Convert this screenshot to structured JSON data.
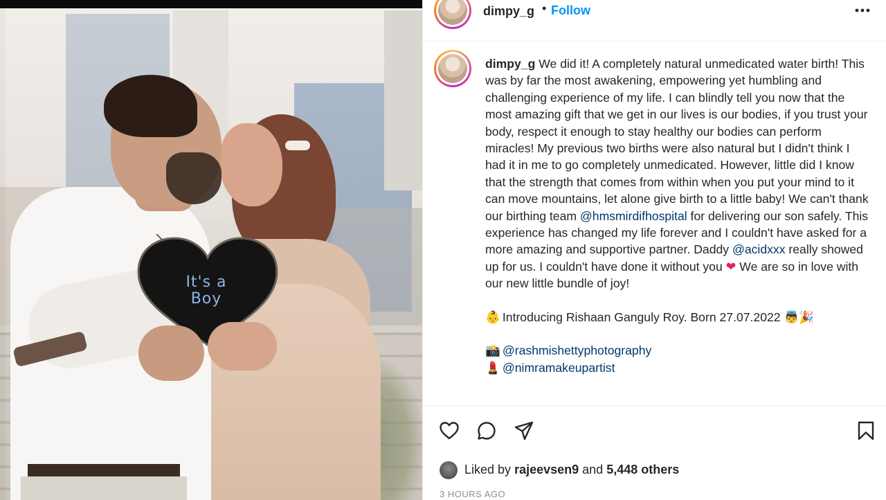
{
  "header": {
    "username": "dimpy_g",
    "separator": "•",
    "follow_label": "Follow",
    "more_icon": "more-horizontal-icon"
  },
  "photo": {
    "sign_line1": "It's a",
    "sign_line2": "Boy"
  },
  "caption": {
    "username": "dimpy_g",
    "text_part1": "We did it! A completely natural unmedicated water birth! This was by far the most awakening, empowering yet humbling and challenging experience of my life. I can blindly tell you now that the most amazing gift that we get in our lives is our bodies, if you trust your body, respect it enough to stay healthy our bodies can perform miracles! My previous two births were also natural but I didn't think I had it in me to go completely unmedicated. However, little did I know that the strength that comes from within when you put your mind to it can move mountains, let alone give birth to a little baby! We can't thank our birthing team ",
    "mention1": "@hmsmirdifhospital",
    "text_part2": " for delivering our son safely. This experience has changed my life forever and I couldn't have asked for a more amazing and supportive partner. Daddy ",
    "mention2": "@acidxxx",
    "text_part3": " really showed up for us. I couldn't have done it without you ",
    "heart_emoji": "❤",
    "text_part4": " We are so in love with our new little bundle of joy!",
    "intro_emoji": "👶",
    "intro_text": "Introducing Rishaan Ganguly Roy. Born 27.07.2022",
    "intro_emoji_end": "👼🎉",
    "credit1_emoji": "📸",
    "credit1": "@rashmishettyphotography",
    "credit2_emoji": "💄",
    "credit2": "@nimramakeupartist"
  },
  "actions": {
    "like_icon": "heart-icon",
    "comment_icon": "comment-icon",
    "share_icon": "share-icon",
    "save_icon": "bookmark-icon"
  },
  "likes": {
    "prefix": "Liked by",
    "user": "rajeevsen9",
    "middle": "and",
    "others": "5,448 others"
  },
  "timestamp": "3 HOURS AGO",
  "colors": {
    "follow": "#0095f6",
    "mention": "#00376b",
    "heart": "#e0245e",
    "text": "#262626",
    "muted": "#8e8e8e"
  }
}
